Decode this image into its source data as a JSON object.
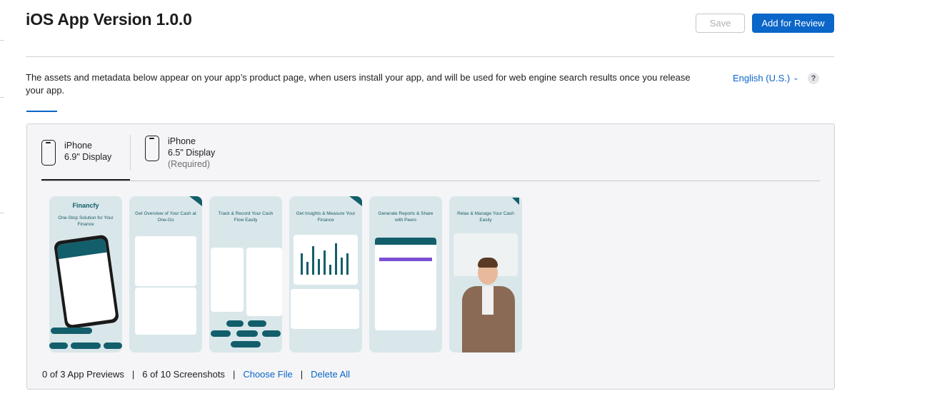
{
  "header": {
    "title": "iOS App Version 1.0.0",
    "save_label": "Save",
    "review_label": "Add for Review"
  },
  "info": {
    "description": "The assets and metadata below appear on your app’s product page, when users install your app, and will be used for web engine search results once you release your app.",
    "language": "English (U.S.)",
    "help": "?"
  },
  "devices": [
    {
      "line1": "iPhone",
      "line2": "6.9\" Display",
      "line3": ""
    },
    {
      "line1": "iPhone",
      "line2": "6.5\" Display",
      "line3": "(Required)"
    }
  ],
  "screenshots": [
    {
      "brand": "Financfy",
      "caption": "One-Stop Solution for Your Finance"
    },
    {
      "caption": "Get Overview of Your Cash at One-Go"
    },
    {
      "caption": "Track & Record Your Cash Flow Easily"
    },
    {
      "caption": "Get Insights & Measure Your Finance"
    },
    {
      "caption": "Generate Reports & Share with Peers"
    },
    {
      "caption": "Relax & Manage Your Cash Easily"
    }
  ],
  "footer": {
    "previews": "0 of 3 App Previews",
    "screenshots": "6 of 10 Screenshots",
    "choose_file": "Choose File",
    "delete_all": "Delete All",
    "separator": "|"
  },
  "colors": {
    "accent": "#0a66c8",
    "brand_teal": "#135e6b",
    "panel_bg": "#f5f5f7"
  }
}
